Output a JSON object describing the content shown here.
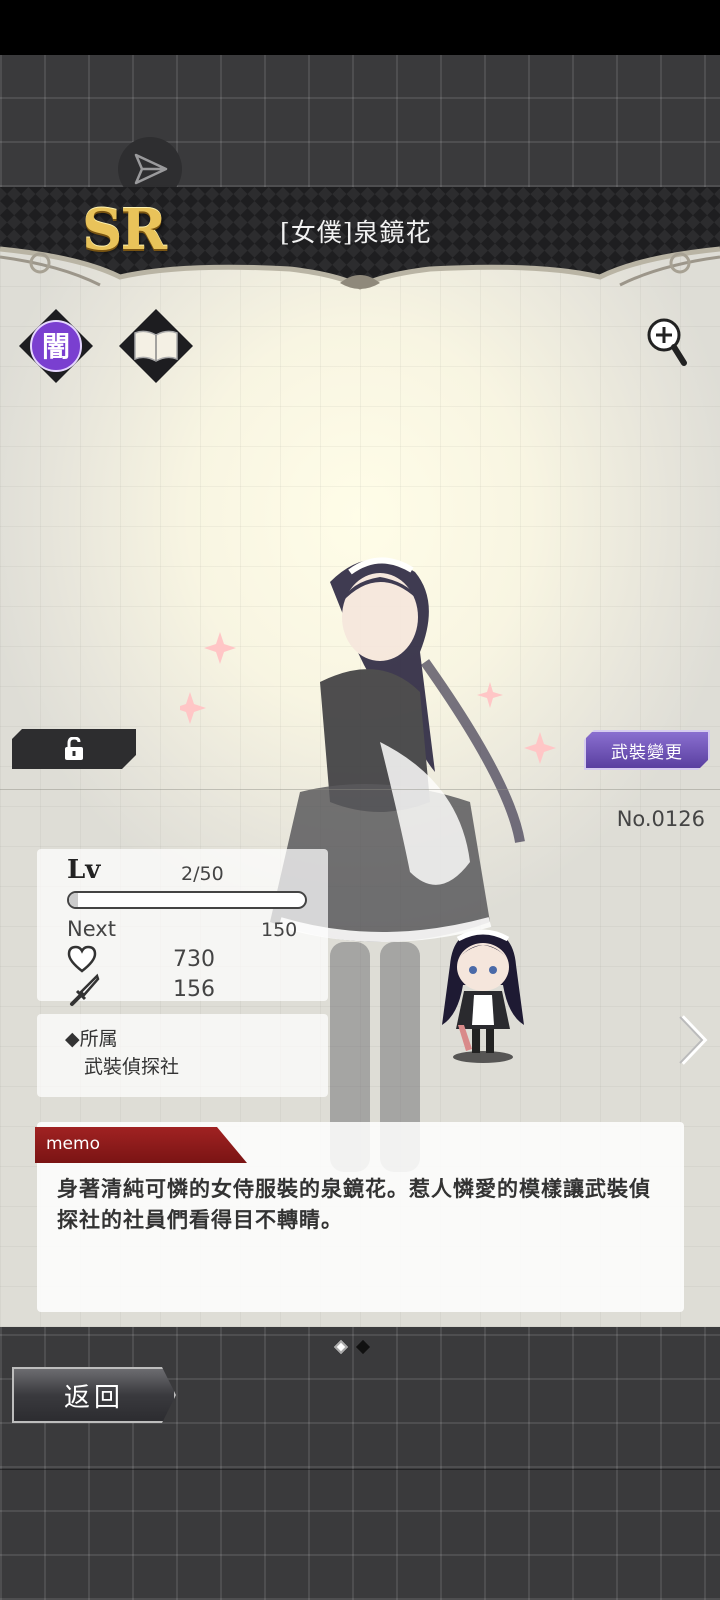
{
  "card": {
    "rarity": "SR",
    "name": "[女僕]泉鏡花",
    "attribute_label": "闇",
    "number": "No.0126",
    "equip_button_label": "武裝變更"
  },
  "stats": {
    "lv_label": "Lv",
    "lv_value": "2/50",
    "exp_progress": 0.04,
    "next_label": "Next",
    "next_value": "150",
    "hp_value": "730",
    "atk_value": "156"
  },
  "affiliation": {
    "title": "◆所属",
    "value": "武裝偵探社"
  },
  "memo": {
    "tab_label": "memo",
    "text": "身著清純可憐的女侍服裝的泉鏡花。惹人憐愛的模樣讓武裝偵探社的社員們看得目不轉睛。"
  },
  "footer": {
    "back_label": "返回",
    "pages": 2,
    "active_page": 1
  },
  "icons": {
    "share": "share-icon",
    "attribute": "dark-attribute-icon",
    "book": "book-icon",
    "zoom": "zoom-in-icon",
    "lock": "unlock-icon",
    "hp": "heart-icon",
    "atk": "sword-icon",
    "next": "chevron-right-icon"
  },
  "colors": {
    "rarity_gold": "#e9c35a",
    "attribute_purple": "#7a3fd0",
    "memo_red": "#8e1a1a",
    "equip_purple": "#6a4fb8"
  }
}
